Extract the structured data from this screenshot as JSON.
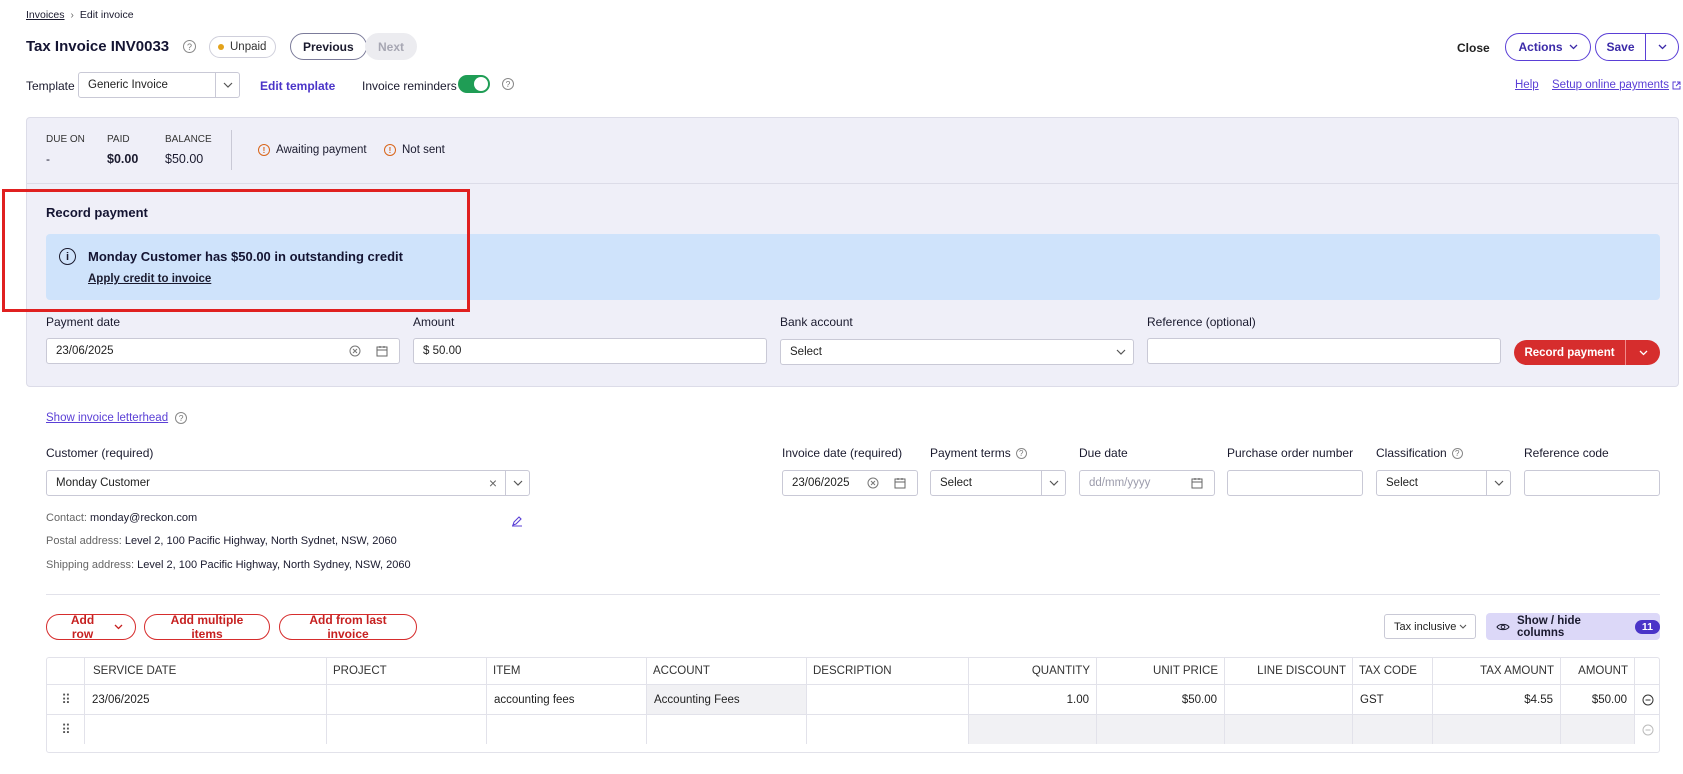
{
  "breadcrumb": {
    "root": "Invoices",
    "current": "Edit invoice"
  },
  "header": {
    "title": "Tax Invoice INV0033",
    "status_badge": "Unpaid",
    "previous_label": "Previous",
    "next_label": "Next",
    "close_label": "Close",
    "actions_label": "Actions",
    "save_label": "Save"
  },
  "template_bar": {
    "template_label": "Template",
    "template_value": "Generic Invoice",
    "edit_template_label": "Edit template",
    "reminders_label": "Invoice reminders",
    "reminders_on": true,
    "help_label": "Help",
    "setup_payments_label": "Setup online payments"
  },
  "summary": {
    "due_on_label": "DUE ON",
    "due_on_value": "-",
    "paid_label": "PAID",
    "paid_value": "$0.00",
    "balance_label": "BALANCE",
    "balance_value": "$50.00",
    "status_awaiting": "Awaiting payment",
    "status_not_sent": "Not sent"
  },
  "record_payment": {
    "heading": "Record payment",
    "credit_message": "Monday Customer has $50.00 in outstanding credit",
    "apply_credit_label": "Apply credit to invoice",
    "payment_date_label": "Payment date",
    "payment_date_value": "23/06/2025",
    "amount_label": "Amount",
    "amount_value": "$ 50.00",
    "bank_account_label": "Bank account",
    "bank_account_value": "Select",
    "reference_label": "Reference (optional)",
    "reference_value": "",
    "record_button_label": "Record payment"
  },
  "invoice_form": {
    "show_letterhead_label": "Show invoice letterhead",
    "customer_label": "Customer (required)",
    "customer_value": "Monday Customer",
    "invoice_date_label": "Invoice date (required)",
    "invoice_date_value": "23/06/2025",
    "payment_terms_label": "Payment terms",
    "payment_terms_value": "Select",
    "due_date_label": "Due date",
    "due_date_placeholder": "dd/mm/yyyy",
    "po_number_label": "Purchase order number",
    "classification_label": "Classification",
    "classification_value": "Select",
    "reference_code_label": "Reference code",
    "contact_label": "Contact:",
    "contact_value": "monday@reckon.com",
    "postal_label": "Postal address:",
    "postal_value": "Level 2, 100 Pacific Highway, North Sydnet, NSW, 2060",
    "shipping_label": "Shipping address:",
    "shipping_value": "Level 2, 100 Pacific Highway, North Sydney, NSW, 2060"
  },
  "line_toolbar": {
    "add_row_label": "Add row",
    "add_multiple_label": "Add multiple items",
    "add_last_label": "Add from last invoice",
    "tax_mode_value": "Tax inclusive",
    "show_hide_label": "Show / hide columns",
    "hidden_count": "11"
  },
  "table": {
    "columns": [
      "SERVICE DATE",
      "PROJECT",
      "ITEM",
      "ACCOUNT",
      "DESCRIPTION",
      "QUANTITY",
      "UNIT PRICE",
      "LINE DISCOUNT",
      "TAX CODE",
      "TAX AMOUNT",
      "AMOUNT"
    ],
    "rows": [
      [
        "23/06/2025",
        "",
        "accounting fees",
        "Accounting Fees",
        "",
        "1.00",
        "$50.00",
        "",
        "GST",
        "$4.55",
        "$50.00"
      ],
      [
        "",
        "",
        "",
        "",
        "",
        "",
        "",
        "",
        "",
        "",
        ""
      ]
    ]
  },
  "colors": {
    "accent_purple": "#5a3fd6",
    "danger_red": "#d62d2d",
    "toggle_green": "#1f9d55",
    "panel_bg": "#efeff8",
    "info_bg": "#cfe3fb",
    "highlight_box": "#e02020"
  }
}
